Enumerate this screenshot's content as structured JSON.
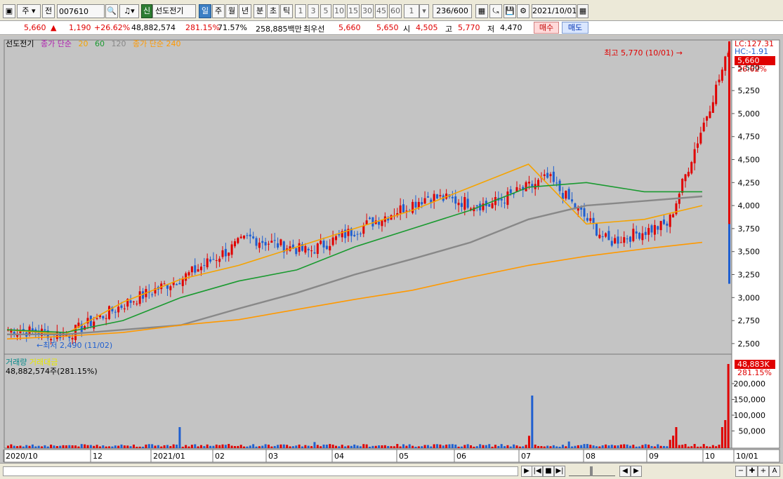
{
  "toolbar": {
    "market": "주",
    "jeon": "전",
    "code": "007610",
    "badge_shin": "신",
    "name": "선도전기",
    "period_tabs": [
      "일",
      "주",
      "월",
      "년",
      "분",
      "초",
      "틱"
    ],
    "interval_nums": [
      "1",
      "3",
      "5",
      "10",
      "15",
      "30",
      "45",
      "60"
    ],
    "count_small": "1",
    "count": "236",
    "count_max": "/600",
    "date": "2021/10/01"
  },
  "quote": {
    "price": "5,660",
    "arrow": "▲",
    "change": "1,190",
    "change_pct": "+26.62%",
    "volume": "48,882,574",
    "vol_ratio": "281.15%",
    "turnover": "71.57%",
    "amount": "258,885백만",
    "priority_label": "최우선",
    "ask": "5,660",
    "bid": "5,650",
    "open_label": "시",
    "open": "4,505",
    "high_label": "고",
    "high": "5,770",
    "low_label": "저",
    "low": "4,470",
    "buy_label": "매수",
    "sell_label": "매도"
  },
  "legend": {
    "name": "선도전기",
    "ma_label": "종가 단순",
    "ma20": "20",
    "ma60": "60",
    "ma120": "120",
    "ma240_label": "종가 단순 240"
  },
  "price_axis": {
    "lc": "LC:127.31",
    "hc": "HC:-1.91",
    "current": "5,660",
    "current_pct": "26.62%",
    "ticks": [
      "5,500",
      "5,250",
      "5,000",
      "4,750",
      "4,500",
      "4,250",
      "4,000",
      "3,750",
      "3,500",
      "3,250",
      "3,000",
      "2,750",
      "2,500"
    ]
  },
  "annotations": {
    "high": "최고 5,770 (10/01)",
    "low": "최저 2,490 (11/02)"
  },
  "volume": {
    "legend_vol": "거래량",
    "legend_amt": "거래대금",
    "summary": "48,882,574주(281.15%)",
    "current": "48,883K",
    "current_pct": "281.15%",
    "ticks": [
      "200,000",
      "150,000",
      "100,000",
      "50,000"
    ]
  },
  "date_axis": [
    "2020/10",
    "12",
    "2021/01",
    "02",
    "03",
    "04",
    "05",
    "06",
    "07",
    "08",
    "09",
    "10",
    "10/01"
  ],
  "colors": {
    "up": "#e00000",
    "down": "#1f5fd0",
    "ma20": "#f5a300",
    "ma60": "#1a9a30",
    "ma120": "#888888",
    "ma240": "#ff9900",
    "bg": "#c4c4c4"
  },
  "chart_data": {
    "type": "candlestick",
    "title": "선도전기",
    "ylim": [
      2400,
      5800
    ],
    "x": [
      "2020/10",
      "12",
      "2021/01",
      "02",
      "03",
      "04",
      "05",
      "06",
      "07",
      "08",
      "09",
      "10"
    ],
    "last_close": 5660,
    "high": 5770,
    "low": 2490,
    "series": [
      {
        "name": "20",
        "values": [
          2650,
          2600,
          2950,
          3200,
          3350,
          3550,
          3750,
          3950,
          4200,
          4450,
          3800,
          3850,
          4000
        ]
      },
      {
        "name": "60",
        "values": [
          2650,
          2620,
          2750,
          3000,
          3180,
          3300,
          3550,
          3750,
          3950,
          4200,
          4250,
          4150,
          4150
        ]
      },
      {
        "name": "120",
        "values": [
          2600,
          2600,
          2650,
          2700,
          2880,
          3050,
          3250,
          3420,
          3600,
          3850,
          4000,
          4050,
          4100
        ]
      },
      {
        "name": "240",
        "values": [
          2550,
          2580,
          2620,
          2700,
          2760,
          2870,
          2980,
          3080,
          3220,
          3350,
          3450,
          3530,
          3600
        ]
      }
    ]
  }
}
